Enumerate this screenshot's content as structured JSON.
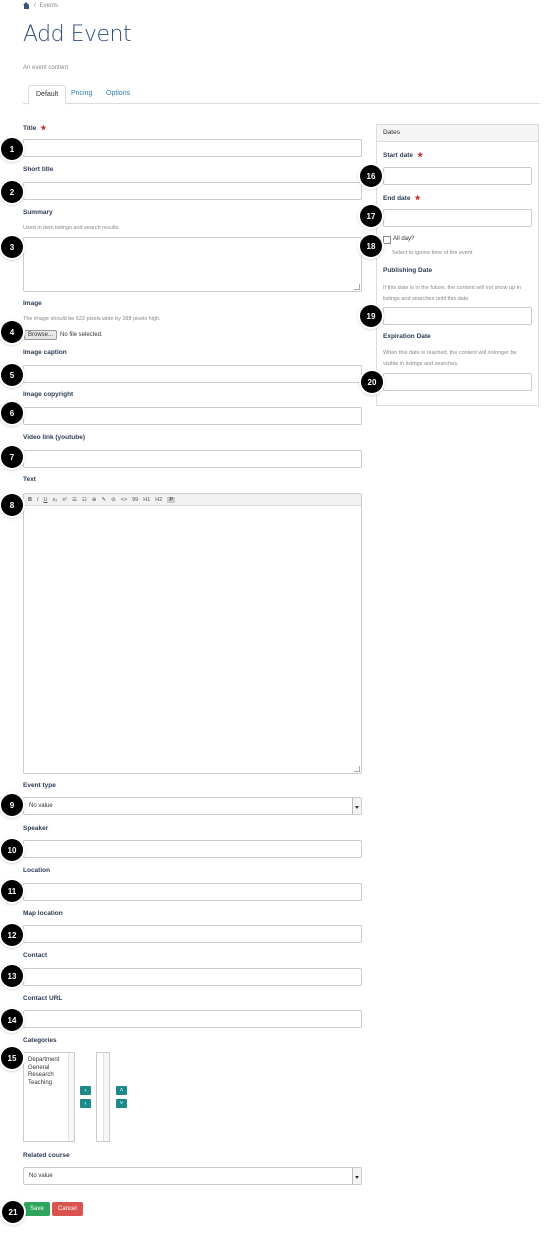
{
  "breadcrumb": {
    "home_icon": "home-icon",
    "separator": "/",
    "current": "Events"
  },
  "page": {
    "title": "Add Event",
    "subtitle": "An event content."
  },
  "tabs": [
    {
      "label": "Default"
    },
    {
      "label": "Pricing"
    },
    {
      "label": "Options"
    }
  ],
  "form": {
    "title": {
      "label": "Title",
      "required": "★"
    },
    "short_title": {
      "label": "Short title"
    },
    "summary": {
      "label": "Summary",
      "help": "Used in item listings and search results."
    },
    "image": {
      "label": "Image",
      "help": "The image should be 622 pixels wide by 288 pixels high.",
      "browse_label": "Browse...",
      "file_status": "No file selected."
    },
    "image_caption": {
      "label": "Image caption"
    },
    "image_copyright": {
      "label": "Image copyright"
    },
    "video_link": {
      "label": "Video link (youtube)"
    },
    "text": {
      "label": "Text",
      "toolbar": [
        "B",
        "I",
        "U",
        "x₂",
        "x²",
        "☰",
        "☷",
        "⊕",
        "✎",
        "⊘",
        "<>",
        "99",
        "H1",
        "H2",
        "P"
      ]
    },
    "event_type": {
      "label": "Event type",
      "value": "No value"
    },
    "speaker": {
      "label": "Speaker"
    },
    "location": {
      "label": "Location"
    },
    "map_location": {
      "label": "Map location"
    },
    "contact": {
      "label": "Contact"
    },
    "contact_url": {
      "label": "Contact URL"
    },
    "categories": {
      "label": "Categories",
      "options": [
        "Department",
        "General",
        "Research",
        "Teaching"
      ],
      "add_icon": "arrow-right-icon",
      "remove_icon": "arrow-left-icon",
      "up_icon": "chevron-up-icon",
      "down_icon": "chevron-down-icon"
    },
    "related_course": {
      "label": "Related course",
      "value": "No value"
    },
    "save_label": "Save",
    "cancel_label": "Cancel"
  },
  "dates_panel": {
    "heading": "Dates",
    "start_date": {
      "label": "Start date",
      "required": "★"
    },
    "end_date": {
      "label": "End date",
      "required": "★"
    },
    "all_day": {
      "label": "All day?",
      "help": "Select to ignore time of the event"
    },
    "publishing_date": {
      "label": "Publishing Date",
      "help": "If this date is in the future, the content will not show up in listings and searches until this date."
    },
    "expiration_date": {
      "label": "Expiration Date",
      "help": "When this date is reached, the content will nolonger be visible in listings and searches."
    }
  },
  "callouts": [
    "1",
    "2",
    "3",
    "4",
    "5",
    "6",
    "7",
    "8",
    "9",
    "10",
    "11",
    "12",
    "13",
    "14",
    "15",
    "16",
    "17",
    "18",
    "19",
    "20",
    "21"
  ],
  "colors": {
    "title": "#2d4e78",
    "link": "#2a7fae",
    "required": "#c9302c",
    "save": "#2ea55a",
    "cancel": "#d9534f",
    "teal": "#1a8a8a"
  }
}
